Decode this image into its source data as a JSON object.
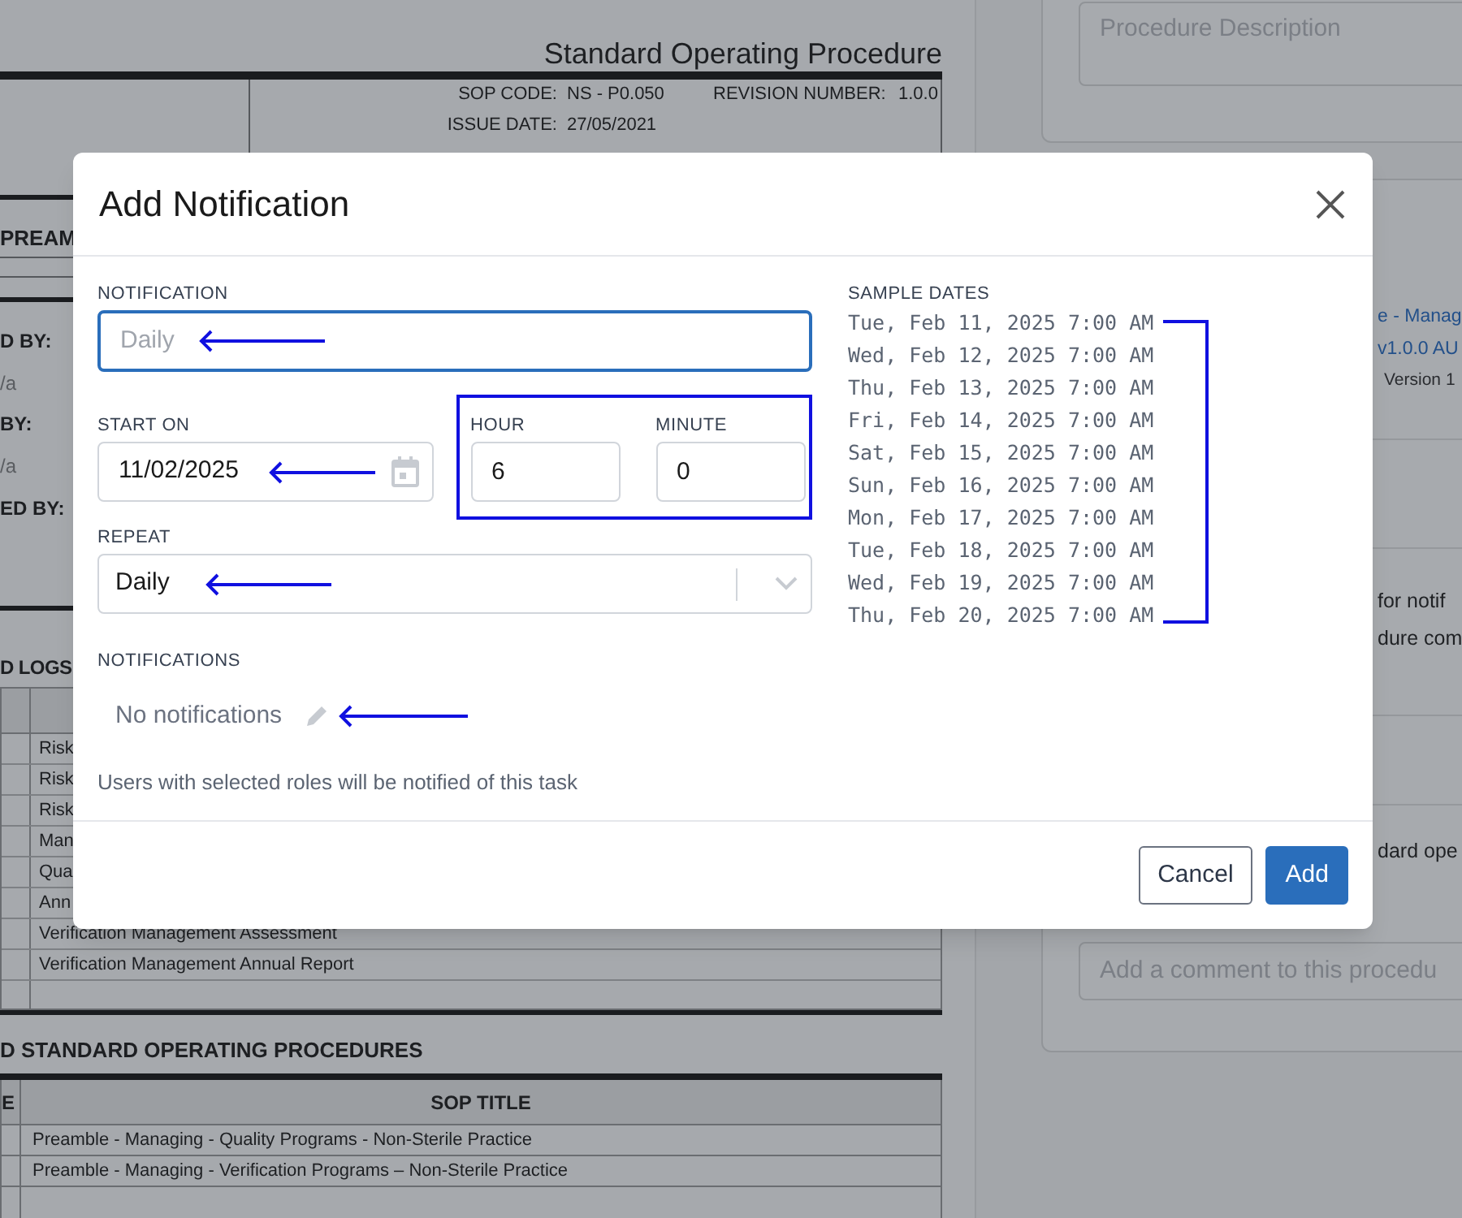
{
  "document": {
    "title": "Standard Operating Procedure",
    "header_rows": [
      {
        "label": "SOP CODE:",
        "value": "NS - P0.050",
        "label_2": "REVISION NUMBER:",
        "value_2": "1.0.0"
      },
      {
        "label": "ISSUE DATE:",
        "value": "27/05/2021"
      }
    ],
    "section_1": "PREAM",
    "sign_rows": [
      {
        "kind": "label",
        "text": "D BY:"
      },
      {
        "kind": "value",
        "text": "/a"
      },
      {
        "kind": "label",
        "text": "BY:"
      },
      {
        "kind": "value",
        "text": "/a"
      },
      {
        "kind": "label",
        "text": "ED BY:"
      }
    ],
    "section_2": "D LOGS",
    "log_rows": [
      "Risk",
      "Risk",
      "Risk",
      "Man",
      "Qua",
      "Ann",
      "Verification Management Assessment",
      "Verification Management Annual Report"
    ],
    "section_3": "D STANDARD OPERATING PROCEDURES",
    "sop_table": {
      "columns": [
        "E",
        "SOP TITLE"
      ],
      "rows": [
        "Preamble - Managing - Quality Programs - Non-Sterile Practice",
        "Preamble - Managing - Verification Programs – Non-Sterile Practice"
      ]
    }
  },
  "side_panel": {
    "description_placeholder": "Procedure Description",
    "link_lines": [
      "e - Manag",
      "v1.0.0 AU"
    ],
    "version": "Version 1",
    "text_lines": [
      "for notif",
      "dure com"
    ],
    "text_2": "dard ope",
    "comment_placeholder": "Add a comment to this procedu"
  },
  "dialog": {
    "title": "Add Notification",
    "notification": {
      "label": "NOTIFICATION",
      "placeholder": "Daily",
      "focused": true
    },
    "start_on": {
      "label": "START ON",
      "value": "11/02/2025"
    },
    "hour": {
      "label": "HOUR",
      "value": "6"
    },
    "minute": {
      "label": "MINUTE",
      "value": "0"
    },
    "repeat": {
      "label": "REPEAT",
      "value": "Daily"
    },
    "notifications": {
      "label": "NOTIFICATIONS",
      "empty_text": "No notifications",
      "help": "Users with selected roles will be notified of this task"
    },
    "sample_dates": {
      "label": "SAMPLE DATES",
      "dates": [
        "Tue, Feb 11, 2025 7:00 AM",
        "Wed, Feb 12, 2025 7:00 AM",
        "Thu, Feb 13, 2025 7:00 AM",
        "Fri, Feb 14, 2025 7:00 AM",
        "Sat, Feb 15, 2025 7:00 AM",
        "Sun, Feb 16, 2025 7:00 AM",
        "Mon, Feb 17, 2025 7:00 AM",
        "Tue, Feb 18, 2025 7:00 AM",
        "Wed, Feb 19, 2025 7:00 AM",
        "Thu, Feb 20, 2025 7:00 AM"
      ]
    },
    "buttons": [
      {
        "label": "Cancel",
        "kind": "secondary"
      },
      {
        "label": "Add",
        "kind": "primary"
      }
    ]
  }
}
